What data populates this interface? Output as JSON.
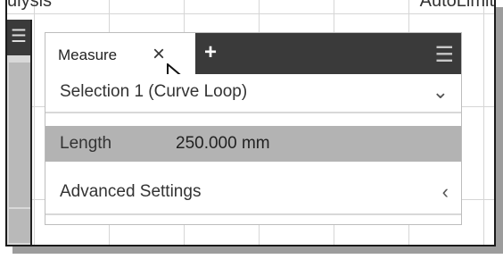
{
  "top": {
    "left_text": "ulysis",
    "right_text": "AutoLimit"
  },
  "panel": {
    "tab_label": "Measure",
    "close_glyph": "×",
    "add_glyph": "+",
    "menu_glyph": "☰",
    "selection_label": "Selection 1 (Curve Loop)",
    "selection_icon": "⌄",
    "length_label": "Length",
    "length_value": "250.000 mm",
    "advanced_label": "Advanced Settings",
    "advanced_icon": "‹"
  },
  "icons": {
    "close": "close-icon",
    "add": "plus-icon",
    "menu": "menu-icon",
    "collapse": "chevron-down-icon",
    "expand": "chevron-left-icon",
    "cursor": "cursor-icon"
  }
}
